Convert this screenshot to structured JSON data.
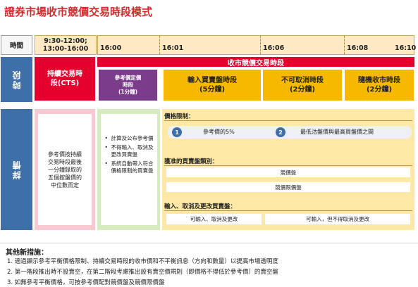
{
  "title": "證券市場收市競價交易時段模式",
  "header": {
    "time_label": "時間",
    "continuous_time": [
      "9:30-12:00;",
      "13:00-16:00"
    ],
    "ticks": [
      "16:00",
      "16:01",
      "16:06",
      "16:08",
      "16:10"
    ]
  },
  "rows": {
    "sessions_label": "時段",
    "details_label": "詳情"
  },
  "phases": {
    "continuous": [
      "持續交易時",
      "段(CTS)"
    ],
    "cas_bar": "收市競價交易時段",
    "reference_price": [
      "參考價定價",
      "時段",
      "(1分鐘)"
    ],
    "order_input": [
      "輸入買賣盤時段",
      "(5分鐘)"
    ],
    "no_cancel": [
      "不可取消時段",
      "(2分鐘)"
    ],
    "random_close": [
      "隨機收市時段",
      "(2分鐘)"
    ]
  },
  "details": {
    "reference_calc": [
      "參考價按持續",
      "交易時段最後",
      "一分鐘錄取的",
      "五個按盤價的",
      "中位數而定"
    ],
    "bullets": [
      "計算及公布參考價",
      "不得輸入、取消及更改買賣盤",
      "系統自動帶入符合價格限制的買賣盤"
    ],
    "price_limit_title": "價格限制：",
    "price_limit_items": [
      {
        "num": "1",
        "text": "參考價的5%"
      },
      {
        "num": "2",
        "text": "最低沽盤價與最高買盤價之間"
      }
    ],
    "order_types_title": "獲准的買賣盤類別：",
    "order_types": [
      "競價盤",
      "競價限價盤"
    ],
    "input_cancel_title": "輸入、取消及更改買賣盤：",
    "input_cancel_left": "可輸入、取消及更改",
    "input_cancel_right": "可輸入，但不得取消及更改"
  },
  "notes": {
    "title": "其他新措施：",
    "items": [
      "1.  適過顯示參考平衡價格限制、持續交易時段的收市價和不平衡訊息（方向和數量）以提高市場透明度",
      "2.  第一階段推出時不設賣空，在第二階段考慮推出設有賣空價規則（即價格不得低於參考價）的賣空盤",
      "3.  如無參考平衡價格，可按參考價配對競價盤及競價限價盤"
    ]
  },
  "colors": {
    "title_red": "#d42a2a",
    "session_red": "#e5002d",
    "purple": "#7a3c8b",
    "gold": "#f6b900",
    "side_blue": "#3f6fa8",
    "pink": "#f8c9d0",
    "green": "#d6ecc0",
    "yellow": "#fde9a5",
    "header_beige": "#fde9c4"
  }
}
